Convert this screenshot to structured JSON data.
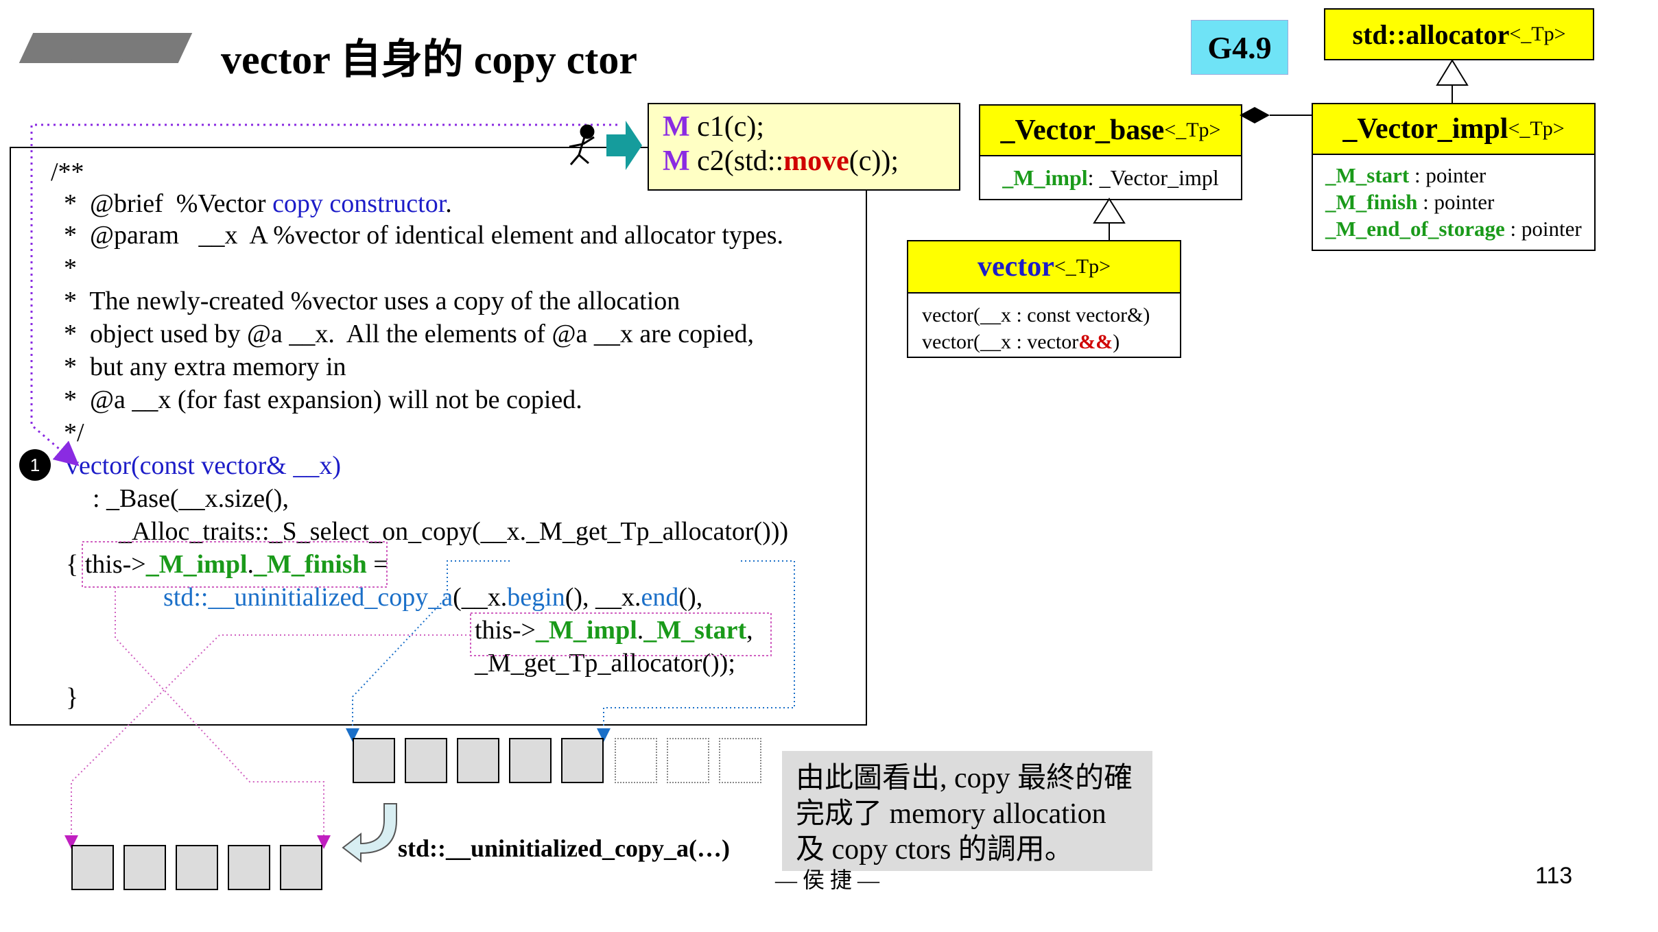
{
  "header": {
    "title": "vector 自身的 copy ctor",
    "version_badge": "G4.9"
  },
  "classes": {
    "allocator": {
      "name": "std::allocator",
      "tparam": "<_Tp>"
    },
    "vector_base": {
      "name": "_Vector_base",
      "tparam": "<_Tp>",
      "member_name": "_M_impl",
      "member_type": " : _Vector_impl"
    },
    "vector_impl": {
      "name": "_Vector_impl",
      "tparam": "<_Tp>",
      "members": [
        {
          "name": "_M_start",
          "type": " : pointer"
        },
        {
          "name": "_M_finish",
          "type": " : pointer"
        },
        {
          "name": "_M_end_of_storage",
          "type": " : pointer"
        }
      ]
    },
    "vector": {
      "name": "vector",
      "tparam": "<_Tp>",
      "ctor1": "vector(__x : const vector&)",
      "ctor2_prefix": "vector(__x : vector",
      "ctor2_refref": "&&",
      "ctor2_suffix": ")"
    }
  },
  "callout": {
    "line1_m": "M",
    "line1_code": " c1(c);",
    "line2_m": "M",
    "line2_pre": " c2(std::",
    "line2_move": "move",
    "line2_post": "(c));"
  },
  "code": {
    "comment": [
      "/**",
      "  *  @brief  %Vector ",
      "  *  @param   __x  A %vector of identical element and allocator types.",
      "  *",
      "  *  The newly-created %vector uses a copy of the allocation",
      "  *  object used by @a __x.  All the elements of @a __x are copied,",
      "  *  but any extra memory in",
      "  *  @a __x (for fast expansion) will not be copied.",
      "  */"
    ],
    "brief_blue": "copy constructor",
    "brief_end": ".",
    "marker": "1",
    "sig": "vector(const vector& __x)",
    "base_line": "  : _Base(__x.size(),",
    "alloc_line": "      _Alloc_traits::_S_select_on_copy(__x._M_get_Tp_allocator()))",
    "brace_open": "{ this->",
    "impl": "_M_impl",
    "dot": ".",
    "finish": "_M_finish",
    "assign": " =",
    "std_call": "std::__uninitialized_copy_a",
    "args_a": "(__x.",
    "begin": "begin",
    "args_b": "(), __x.",
    "end": "end",
    "args_c": "(),",
    "this2": "this->",
    "start": "_M_start",
    "comma": ",",
    "getalloc": "_M_get_Tp_allocator());",
    "brace_close": "}"
  },
  "bottom": {
    "copy_label": "std::__uninitialized_copy_a(…)",
    "note_lines": [
      "由此圖看出, copy 最終的確",
      "完成了 memory allocation",
      "及 copy ctors 的調用。"
    ],
    "author": "— 侯 捷 —",
    "page_number": "113"
  },
  "colors": {
    "class_fill": "#ffff00",
    "badge": "#6fe3f6",
    "member_green": "#1a9a1a",
    "keyword_red": "#d00000",
    "link_blue": "#1c1cc8",
    "arrow_purple": "#8a2be2",
    "arrow_teal": "#159c9c"
  }
}
